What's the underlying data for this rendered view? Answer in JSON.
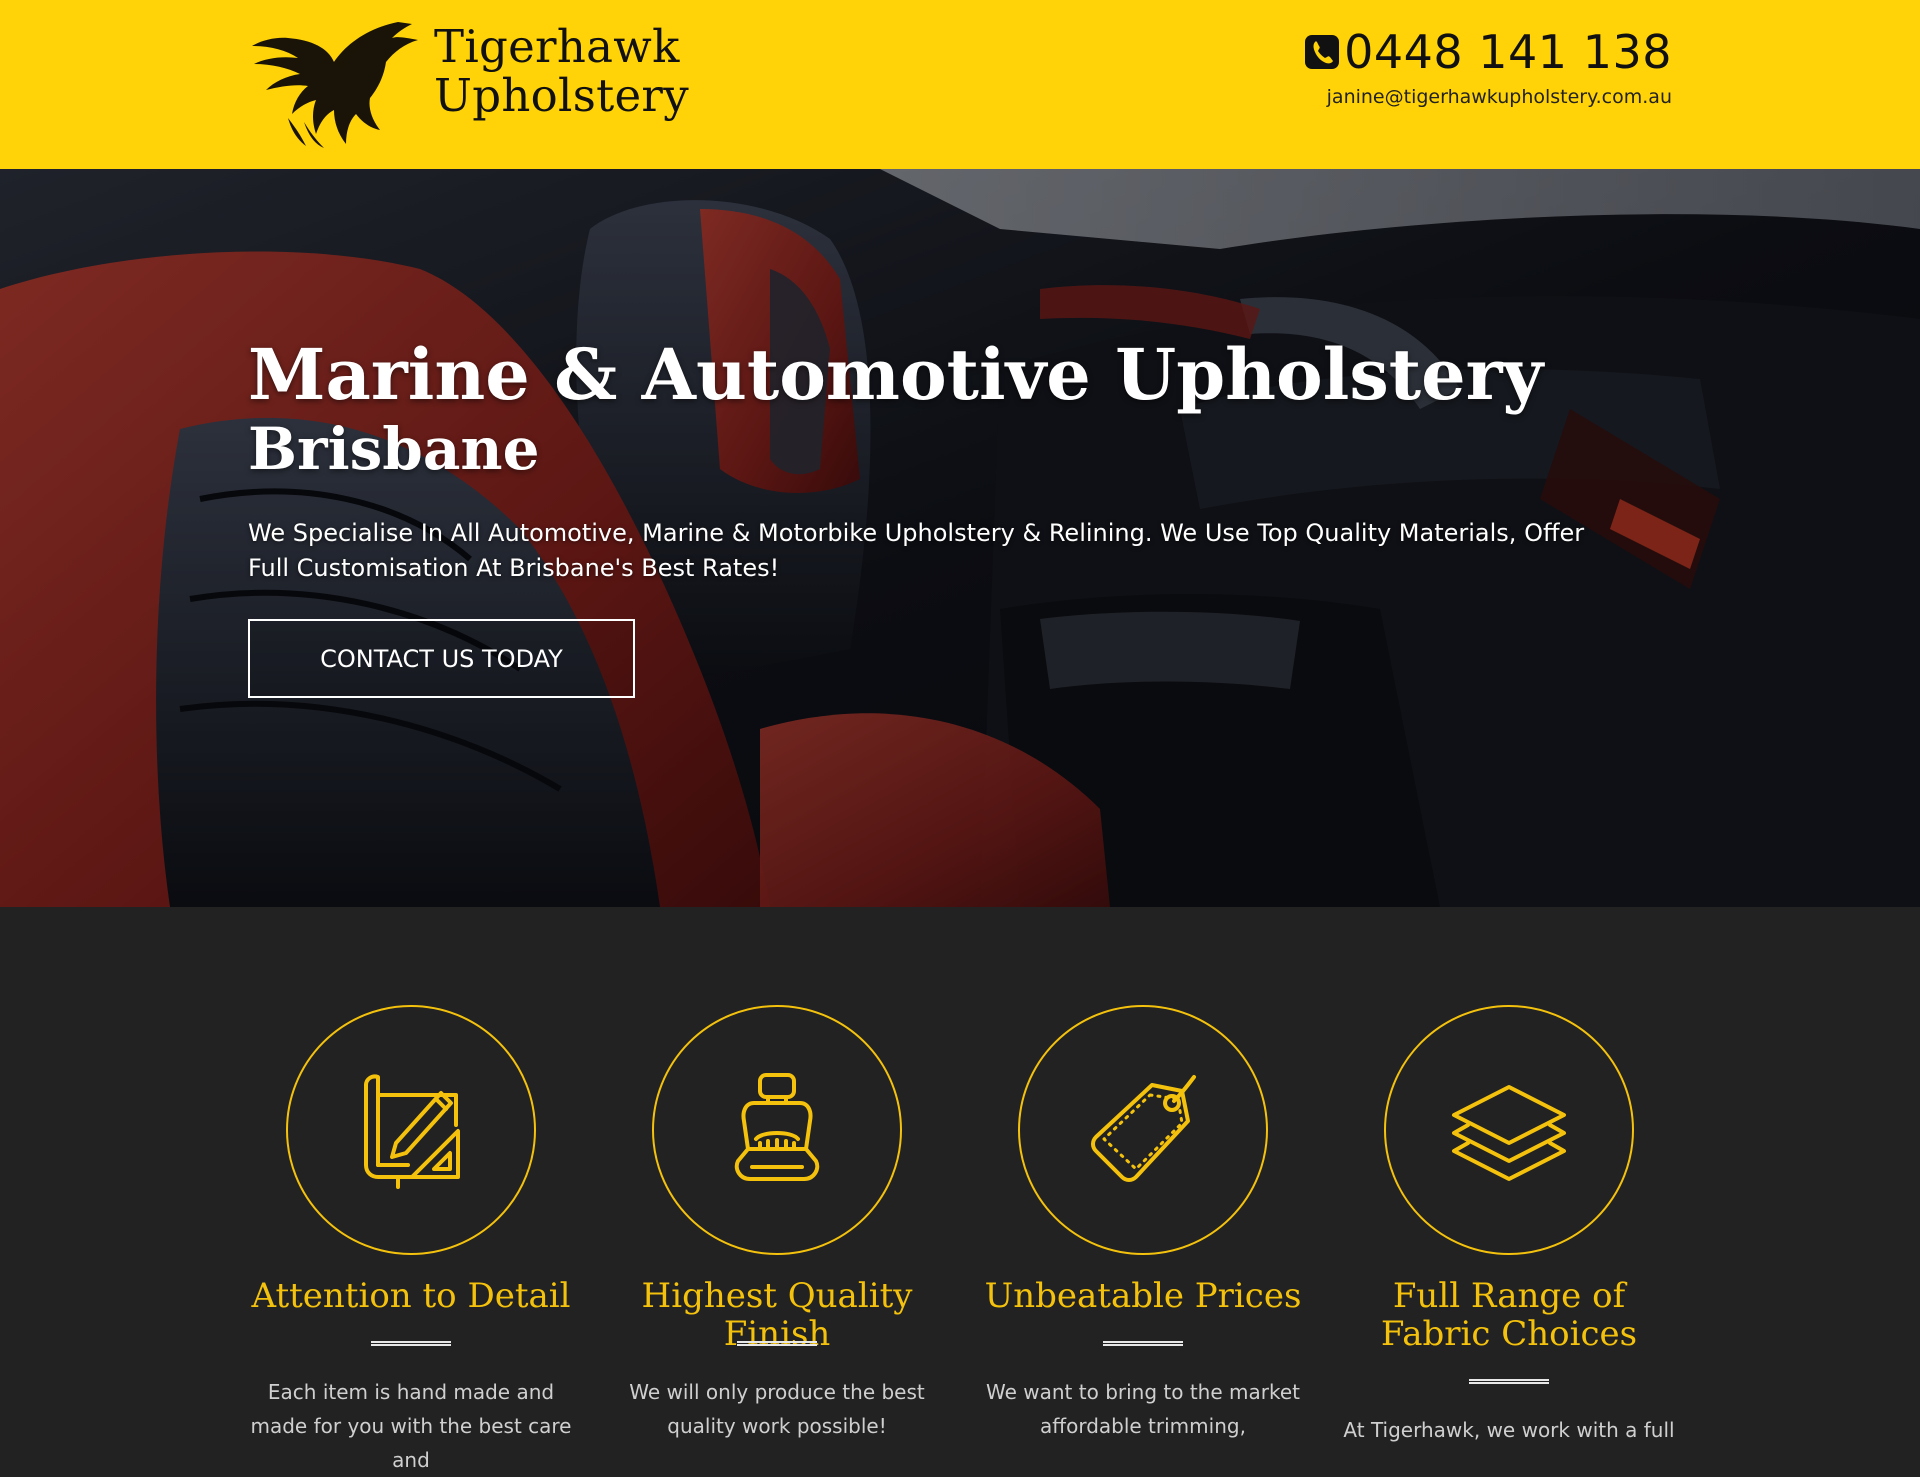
{
  "header": {
    "logo_line1": "Tigerhawk",
    "logo_line2": "Upholstery",
    "phone": "0448 141 138",
    "email": "janine@tigerhawkupholstery.com.au",
    "brand_color": "#ffd307"
  },
  "hero": {
    "title": "Marine & Automotive Upholstery",
    "subtitle": "Brisbane",
    "description": "We Specialise In All Automotive, Marine & Motorbike Upholstery & Relining. We Use Top Quality Materials, Offer Full Customisation At Brisbane's Best Rates!",
    "cta_label": "CONTACT US TODAY"
  },
  "features": {
    "accent_color": "#f4c20d",
    "items": [
      {
        "icon": "blueprint-icon",
        "title": "Attention to Detail",
        "description": "Each item is hand made and made for you with the best care and"
      },
      {
        "icon": "car-seat-icon",
        "title": "Highest Quality Finish",
        "description": "We will only produce the best quality work possible!"
      },
      {
        "icon": "price-tag-icon",
        "title": "Unbeatable Prices",
        "description": "We want to bring to the market affordable trimming,"
      },
      {
        "icon": "fabric-layers-icon",
        "title": "Full Range of Fabric Choices",
        "description": "At Tigerhawk, we work with a full"
      }
    ]
  }
}
